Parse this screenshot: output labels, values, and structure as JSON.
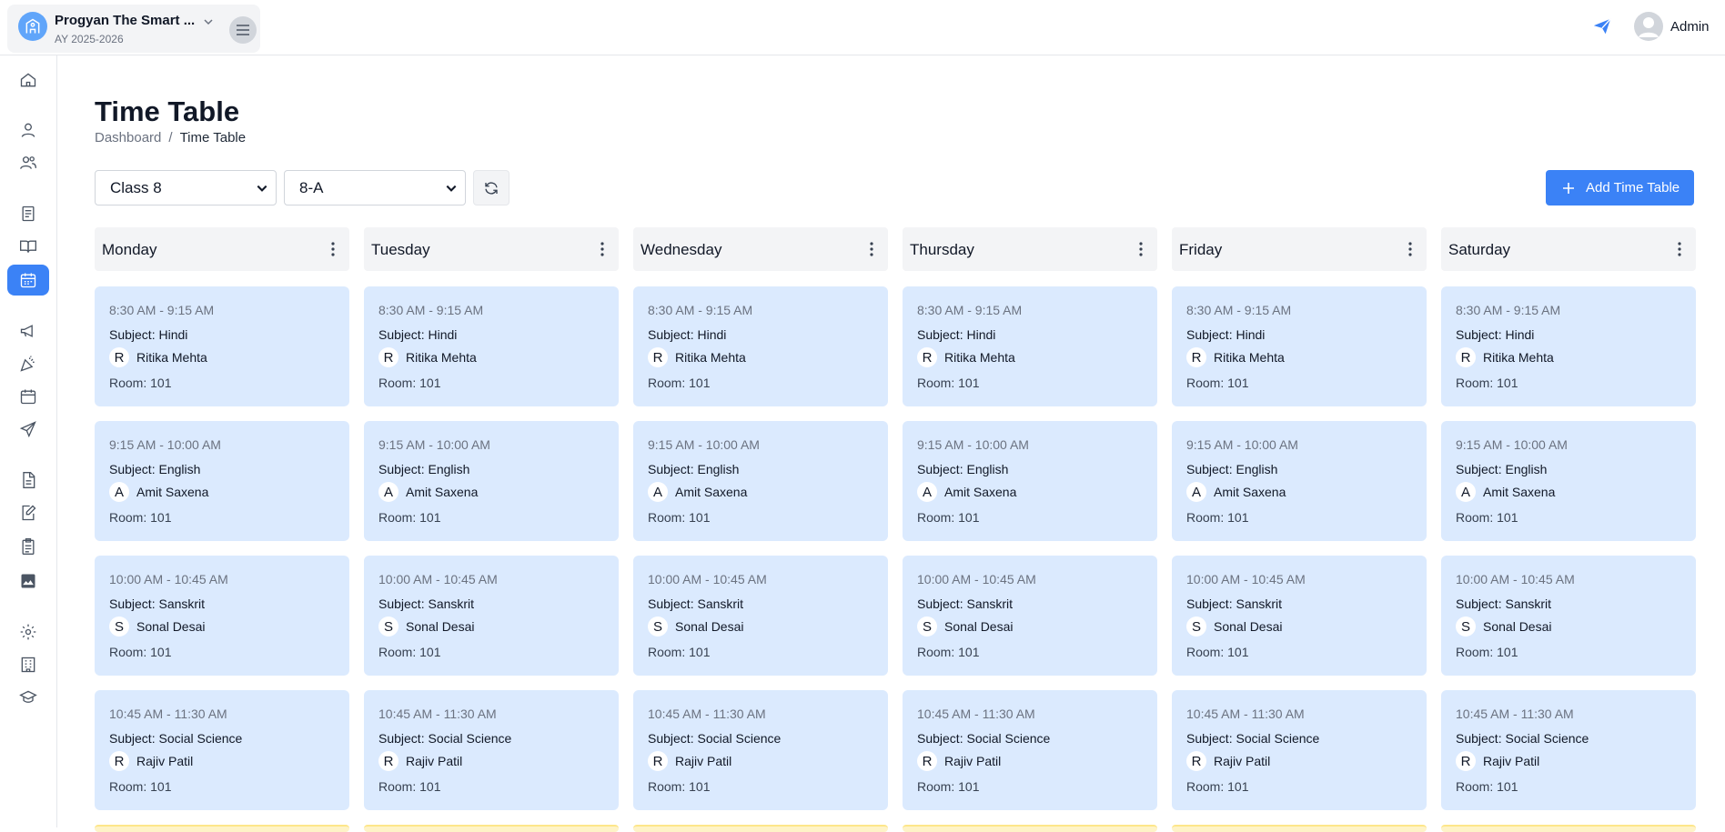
{
  "header": {
    "school_name": "Progyan The Smart ...",
    "academic_year": "AY 2025-2026",
    "user_label": "Admin"
  },
  "sidebar": {
    "items": [
      {
        "name": "home-icon"
      },
      {
        "name": "user-icon"
      },
      {
        "name": "users-icon"
      },
      {
        "name": "book-icon"
      },
      {
        "name": "open-book-icon"
      },
      {
        "name": "calendar-icon",
        "active": true
      },
      {
        "name": "megaphone-icon"
      },
      {
        "name": "party-popper-icon"
      },
      {
        "name": "calendar-check-icon"
      },
      {
        "name": "plane-icon"
      },
      {
        "name": "document-icon"
      },
      {
        "name": "edit-document-icon"
      },
      {
        "name": "clipboard-icon"
      },
      {
        "name": "image-chart-icon"
      },
      {
        "name": "gear-icon"
      },
      {
        "name": "building-icon"
      },
      {
        "name": "graduation-cap-icon"
      }
    ]
  },
  "page": {
    "title": "Time Table",
    "breadcrumb": {
      "parent": "Dashboard",
      "separator": "/",
      "current": "Time Table"
    }
  },
  "filters": {
    "class_value": "Class 8",
    "section_value": "8-A"
  },
  "actions": {
    "add_label": "Add Time Table"
  },
  "days": [
    {
      "name": "Monday"
    },
    {
      "name": "Tuesday"
    },
    {
      "name": "Wednesday"
    },
    {
      "name": "Thursday"
    },
    {
      "name": "Friday"
    },
    {
      "name": "Saturday"
    }
  ],
  "periods": [
    {
      "time": "8:30 AM - 9:15 AM",
      "subject": "Subject: Hindi",
      "initial": "R",
      "teacher": "Ritika Mehta",
      "room": "Room: 101"
    },
    {
      "time": "9:15 AM - 10:00 AM",
      "subject": "Subject: English",
      "initial": "A",
      "teacher": "Amit Saxena",
      "room": "Room: 101"
    },
    {
      "time": "10:00 AM - 10:45 AM",
      "subject": "Subject: Sanskrit",
      "initial": "S",
      "teacher": "Sonal Desai",
      "room": "Room: 101"
    },
    {
      "time": "10:45 AM - 11:30 AM",
      "subject": "Subject: Social Science",
      "initial": "R",
      "teacher": "Rajiv Patil",
      "room": "Room: 101"
    }
  ],
  "colors": {
    "accent": "#3b82f6",
    "period_bg": "#dbeafe",
    "break_bg": "#fef3c7"
  }
}
